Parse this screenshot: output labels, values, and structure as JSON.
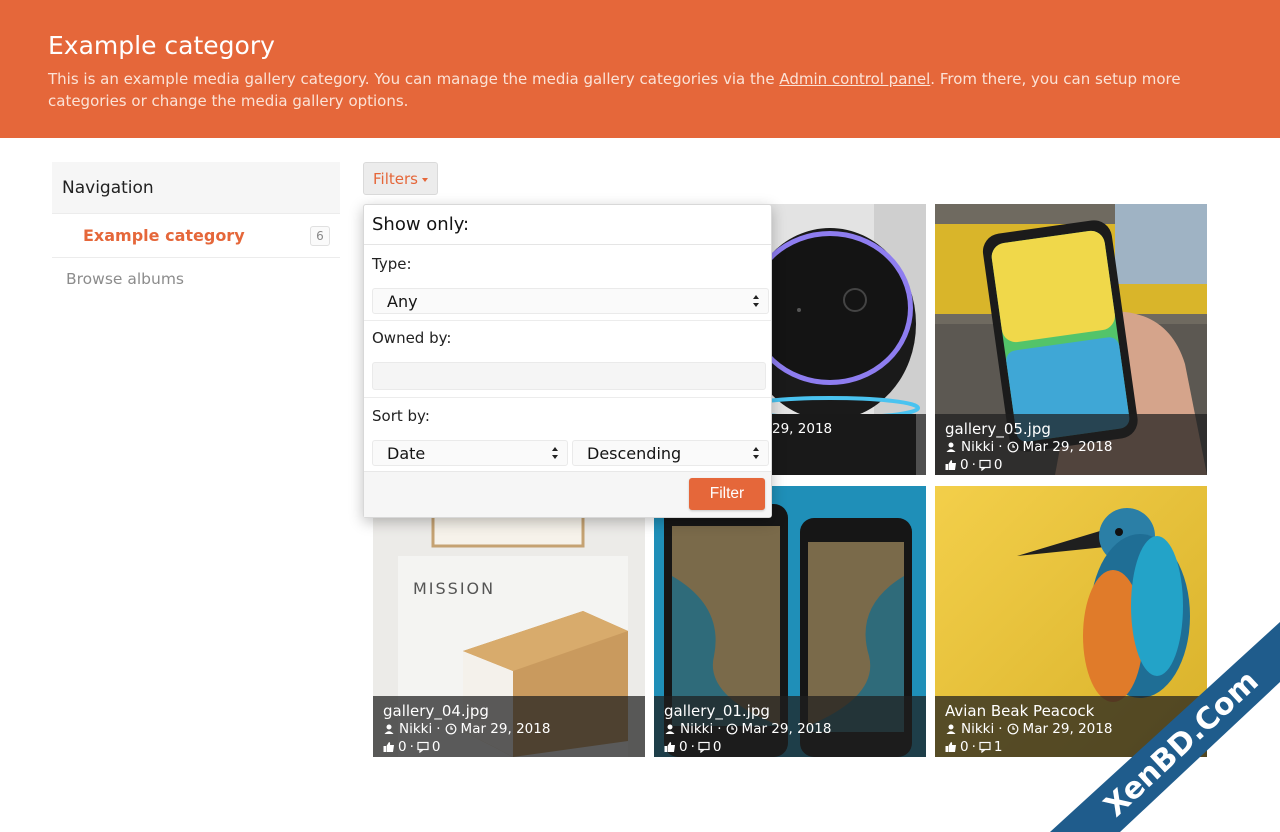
{
  "header": {
    "title": "Example category",
    "desc_before": "This is an example media gallery category. You can manage the media gallery categories via the ",
    "desc_link": "Admin control panel",
    "desc_after": ". From there, you can setup more categories or change the media gallery options."
  },
  "sidebar": {
    "heading": "Navigation",
    "items": [
      {
        "label": "Example category",
        "count": "6"
      }
    ],
    "browse_label": "Browse albums"
  },
  "filters": {
    "button_label": "Filters",
    "show_only": "Show only:",
    "type_label": "Type:",
    "type_value": "Any",
    "owned_label": "Owned by:",
    "owned_value": "",
    "sort_label": "Sort by:",
    "sort_field": "Date",
    "sort_order": "Descending",
    "submit_label": "Filter"
  },
  "gallery": [
    {
      "title": "",
      "user": "",
      "date": "29, 2018",
      "likes": "",
      "comments": ""
    },
    {
      "title": "gallery_05.jpg",
      "user": "Nikki",
      "date": "Mar 29, 2018",
      "likes": "0",
      "comments": "0"
    },
    {
      "title": "gallery_04.jpg",
      "user": "Nikki",
      "date": "Mar 29, 2018",
      "likes": "0",
      "comments": "0"
    },
    {
      "title": "gallery_01.jpg",
      "user": "Nikki",
      "date": "Mar 29, 2018",
      "likes": "0",
      "comments": "0"
    },
    {
      "title": "Avian Beak Peacock",
      "user": "Nikki",
      "date": "Mar 29, 2018",
      "likes": "0",
      "comments": "1"
    }
  ],
  "watermark": "XenBD.Com",
  "colors": {
    "accent": "#e5673a",
    "caption_bg": "#1e1e1e"
  }
}
